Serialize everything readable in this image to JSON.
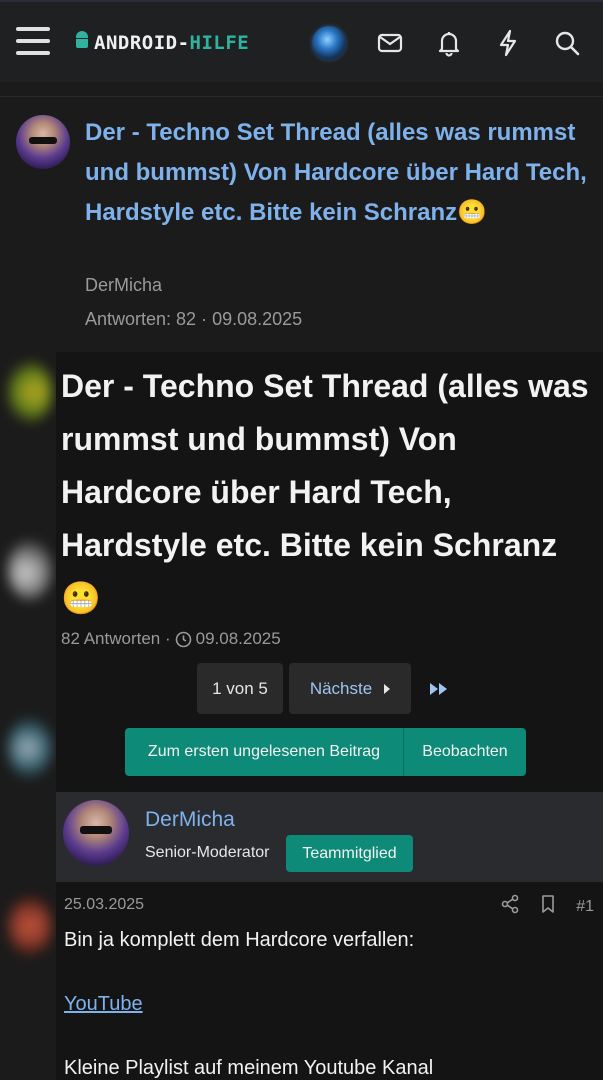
{
  "header": {
    "logo_prefix": "ANDROID-",
    "logo_suffix": "HILFE",
    "icons": [
      "menu-icon",
      "mail-icon",
      "bell-icon",
      "bolt-icon",
      "search-icon"
    ]
  },
  "thread_preview": {
    "title": "Der - Techno Set Thread (alles was rummst und bummst) Von Hardcore über Hard Tech, Hardstyle etc. Bitte kein Schranz😬",
    "author": "DerMicha",
    "meta": "Antworten: 82 · 09.08.2025"
  },
  "thread": {
    "title": "Der - Techno Set Thread (alles was rummst und bummst) Von Hardcore über Hard Tech, Hardstyle etc. Bitte kein Schranz 😬",
    "replies": "82 Antworten ·",
    "date": "09.08.2025",
    "pager": {
      "current": "1 von 5",
      "next": "Nächste"
    },
    "actions": {
      "unread": "Zum ersten ungelesenen Beitrag",
      "watch": "Beobachten"
    }
  },
  "post": {
    "username": "DerMicha",
    "role": "Senior-Moderator",
    "badge": "Teammitglied",
    "date": "25.03.2025",
    "number": "#1",
    "body_line1": "Bin ja komplett dem Hardcore verfallen:",
    "link": "YouTube",
    "body_line2": "Kleine Playlist auf meinem Youtube Kanal"
  },
  "colors": {
    "accent": "#0d8a78",
    "link": "#7fb2ec",
    "background": "#1b1b1b"
  }
}
